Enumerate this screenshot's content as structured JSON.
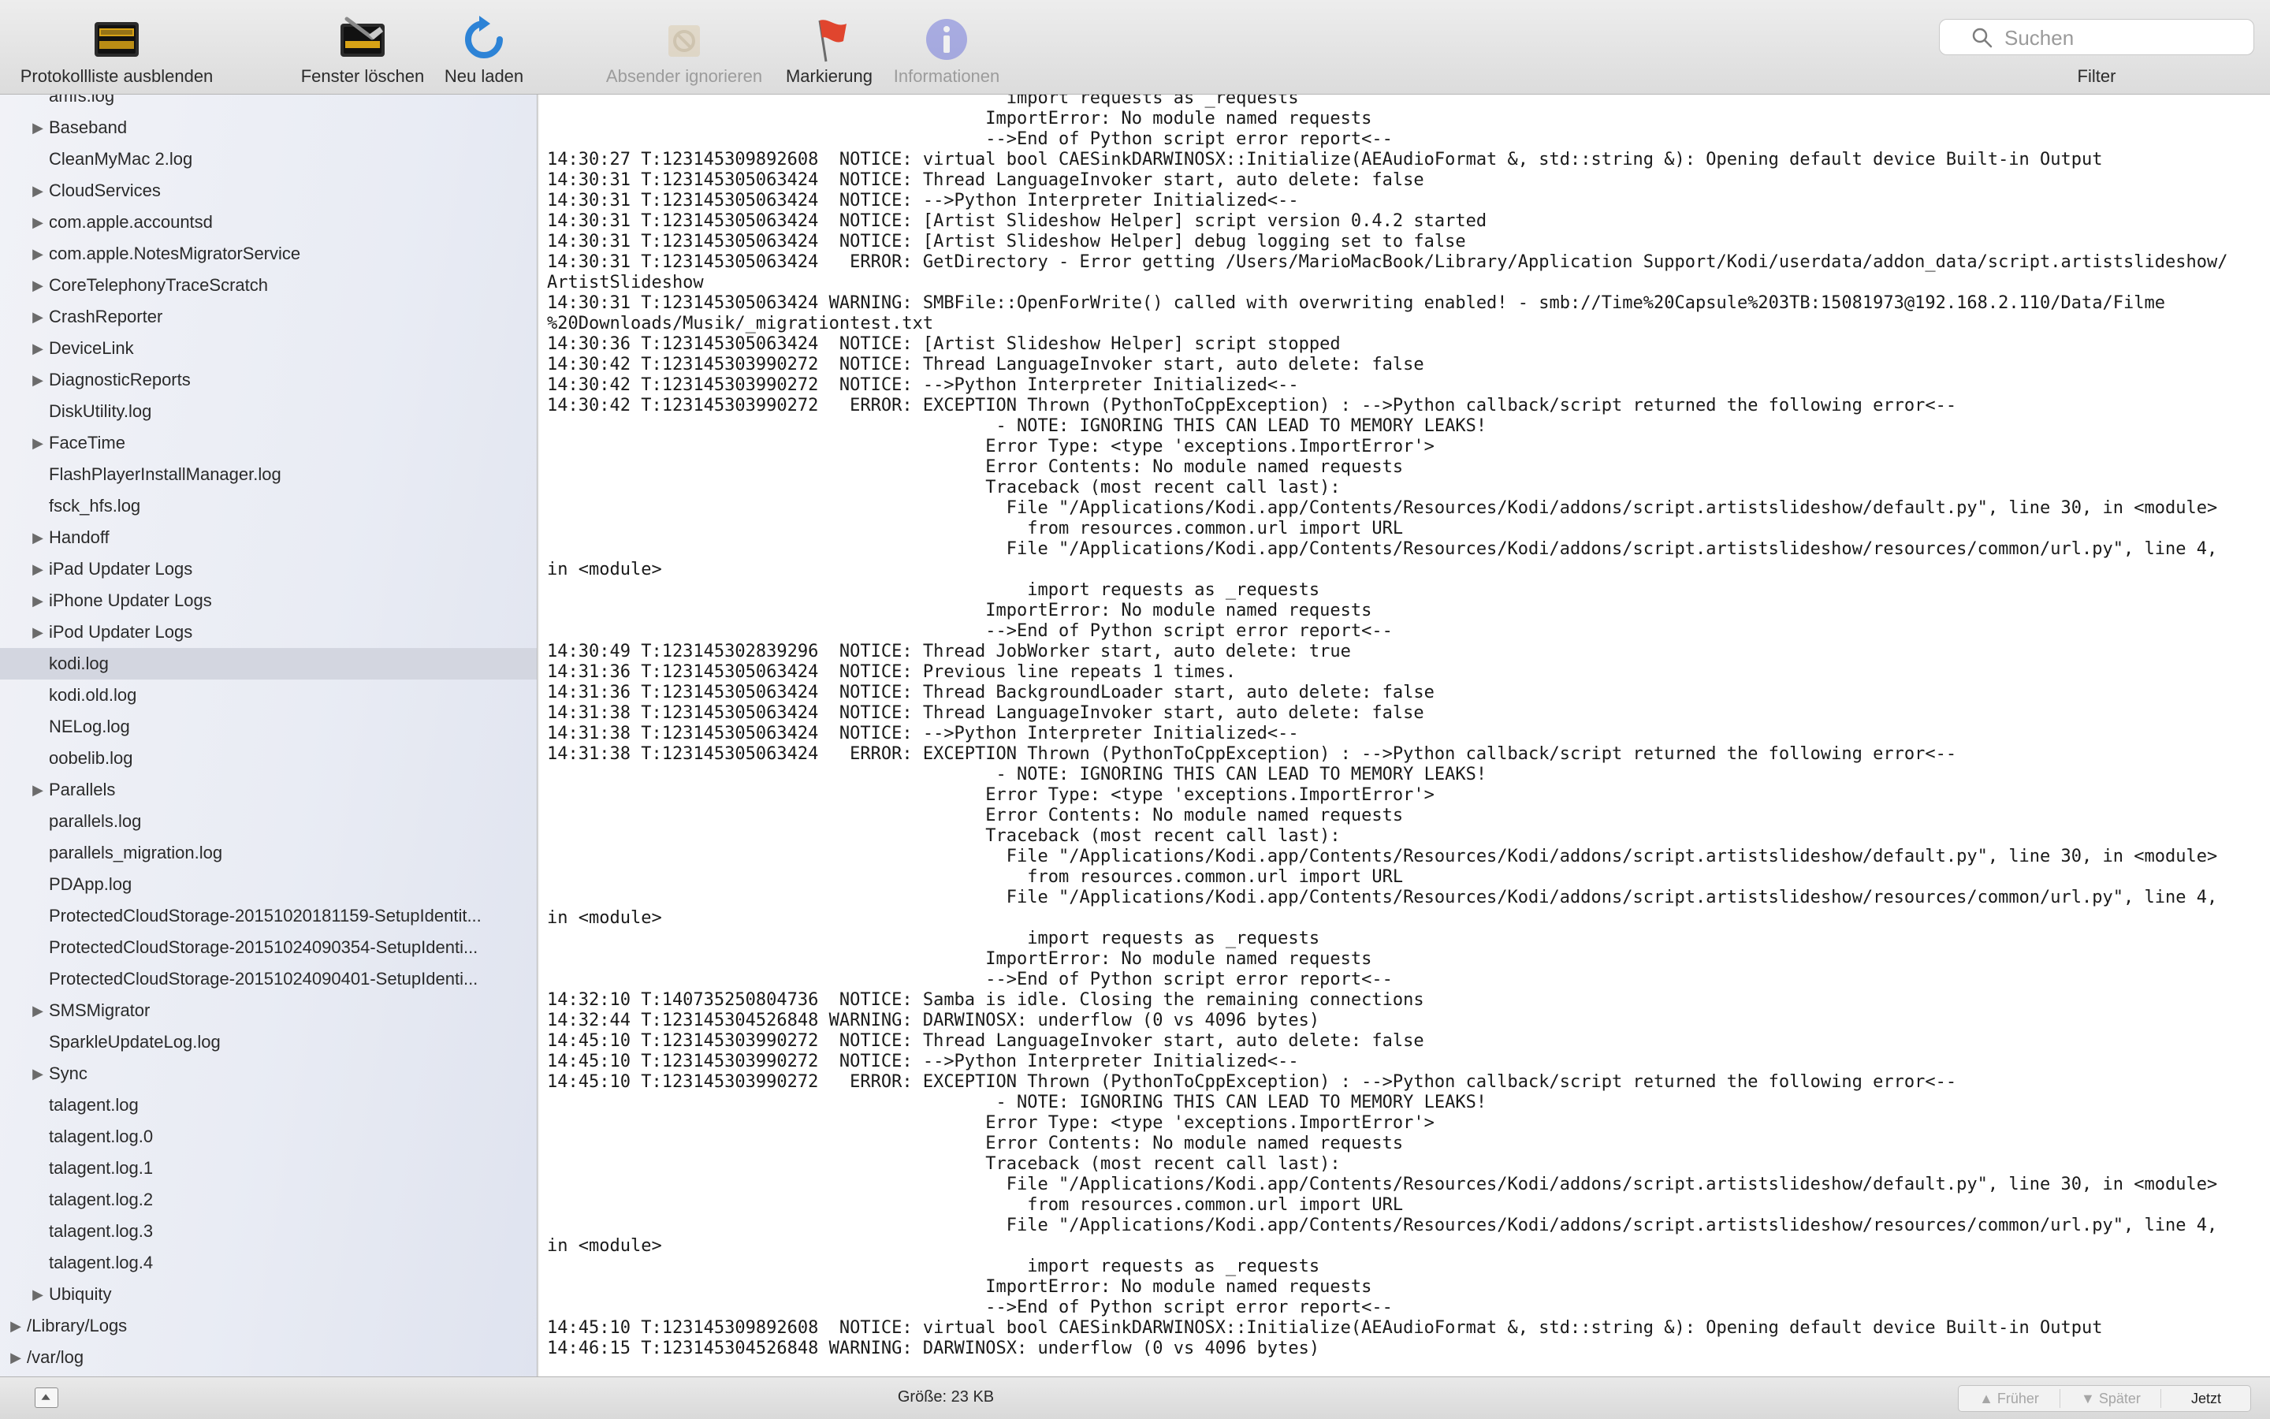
{
  "toolbar": {
    "hide_log_list": "Protokollliste ausblenden",
    "clear_window": "Fenster löschen",
    "reload": "Neu laden",
    "ignore_sender": "Absender ignorieren",
    "mark": "Markierung",
    "info": "Informationen",
    "search_placeholder": "Suchen",
    "filter_label": "Filter"
  },
  "sidebar": {
    "items": [
      {
        "label": "amfs.log",
        "expandable": false
      },
      {
        "label": "Baseband",
        "expandable": true
      },
      {
        "label": "CleanMyMac 2.log",
        "expandable": false
      },
      {
        "label": "CloudServices",
        "expandable": true
      },
      {
        "label": "com.apple.accountsd",
        "expandable": true
      },
      {
        "label": "com.apple.NotesMigratorService",
        "expandable": true
      },
      {
        "label": "CoreTelephonyTraceScratch",
        "expandable": true
      },
      {
        "label": "CrashReporter",
        "expandable": true
      },
      {
        "label": "DeviceLink",
        "expandable": true
      },
      {
        "label": "DiagnosticReports",
        "expandable": true
      },
      {
        "label": "DiskUtility.log",
        "expandable": false
      },
      {
        "label": "FaceTime",
        "expandable": true
      },
      {
        "label": "FlashPlayerInstallManager.log",
        "expandable": false
      },
      {
        "label": "fsck_hfs.log",
        "expandable": false
      },
      {
        "label": "Handoff",
        "expandable": true
      },
      {
        "label": "iPad Updater Logs",
        "expandable": true
      },
      {
        "label": "iPhone Updater Logs",
        "expandable": true
      },
      {
        "label": "iPod Updater Logs",
        "expandable": true
      },
      {
        "label": "kodi.log",
        "expandable": false,
        "selected": true
      },
      {
        "label": "kodi.old.log",
        "expandable": false
      },
      {
        "label": "NELog.log",
        "expandable": false
      },
      {
        "label": "oobelib.log",
        "expandable": false
      },
      {
        "label": "Parallels",
        "expandable": true
      },
      {
        "label": "parallels.log",
        "expandable": false
      },
      {
        "label": "parallels_migration.log",
        "expandable": false
      },
      {
        "label": "PDApp.log",
        "expandable": false
      },
      {
        "label": "ProtectedCloudStorage-20151020181159-SetupIdentit...",
        "expandable": false
      },
      {
        "label": "ProtectedCloudStorage-20151024090354-SetupIdenti...",
        "expandable": false
      },
      {
        "label": "ProtectedCloudStorage-20151024090401-SetupIdenti...",
        "expandable": false
      },
      {
        "label": "SMSMigrator",
        "expandable": true
      },
      {
        "label": "SparkleUpdateLog.log",
        "expandable": false
      },
      {
        "label": "Sync",
        "expandable": true
      },
      {
        "label": "talagent.log",
        "expandable": false
      },
      {
        "label": "talagent.log.0",
        "expandable": false
      },
      {
        "label": "talagent.log.1",
        "expandable": false
      },
      {
        "label": "talagent.log.2",
        "expandable": false
      },
      {
        "label": "talagent.log.3",
        "expandable": false
      },
      {
        "label": "talagent.log.4",
        "expandable": false
      },
      {
        "label": "Ubiquity",
        "expandable": true
      },
      {
        "label": "/Library/Logs",
        "expandable": true,
        "top_level": true
      },
      {
        "label": "/var/log",
        "expandable": true,
        "top_level": true
      }
    ]
  },
  "log_lines": [
    "                                            import requests as _requests",
    "                                          ImportError: No module named requests",
    "                                          -->End of Python script error report<--",
    "14:30:27 T:123145309892608  NOTICE: virtual bool CAESinkDARWINOSX::Initialize(AEAudioFormat &, std::string &): Opening default device Built-in Output",
    "14:30:31 T:123145305063424  NOTICE: Thread LanguageInvoker start, auto delete: false",
    "14:30:31 T:123145305063424  NOTICE: -->Python Interpreter Initialized<--",
    "14:30:31 T:123145305063424  NOTICE: [Artist Slideshow Helper] script version 0.4.2 started",
    "14:30:31 T:123145305063424  NOTICE: [Artist Slideshow Helper] debug logging set to false",
    "14:30:31 T:123145305063424   ERROR: GetDirectory - Error getting /Users/MarioMacBook/Library/Application Support/Kodi/userdata/addon_data/script.artistslideshow/",
    "ArtistSlideshow",
    "14:30:31 T:123145305063424 WARNING: SMBFile::OpenForWrite() called with overwriting enabled! - smb://Time%20Capsule%203TB:15081973@192.168.2.110/Data/Filme",
    "%20Downloads/Musik/_migrationtest.txt",
    "14:30:36 T:123145305063424  NOTICE: [Artist Slideshow Helper] script stopped",
    "14:30:42 T:123145303990272  NOTICE: Thread LanguageInvoker start, auto delete: false",
    "14:30:42 T:123145303990272  NOTICE: -->Python Interpreter Initialized<--",
    "14:30:42 T:123145303990272   ERROR: EXCEPTION Thrown (PythonToCppException) : -->Python callback/script returned the following error<--",
    "                                           - NOTE: IGNORING THIS CAN LEAD TO MEMORY LEAKS!",
    "                                          Error Type: <type 'exceptions.ImportError'>",
    "                                          Error Contents: No module named requests",
    "                                          Traceback (most recent call last):",
    "                                            File \"/Applications/Kodi.app/Contents/Resources/Kodi/addons/script.artistslideshow/default.py\", line 30, in <module>",
    "                                              from resources.common.url import URL",
    "                                            File \"/Applications/Kodi.app/Contents/Resources/Kodi/addons/script.artistslideshow/resources/common/url.py\", line 4,",
    "in <module>",
    "                                              import requests as _requests",
    "                                          ImportError: No module named requests",
    "                                          -->End of Python script error report<--",
    "14:30:49 T:123145302839296  NOTICE: Thread JobWorker start, auto delete: true",
    "14:31:36 T:123145305063424  NOTICE: Previous line repeats 1 times.",
    "14:31:36 T:123145305063424  NOTICE: Thread BackgroundLoader start, auto delete: false",
    "14:31:38 T:123145305063424  NOTICE: Thread LanguageInvoker start, auto delete: false",
    "14:31:38 T:123145305063424  NOTICE: -->Python Interpreter Initialized<--",
    "14:31:38 T:123145305063424   ERROR: EXCEPTION Thrown (PythonToCppException) : -->Python callback/script returned the following error<--",
    "                                           - NOTE: IGNORING THIS CAN LEAD TO MEMORY LEAKS!",
    "                                          Error Type: <type 'exceptions.ImportError'>",
    "                                          Error Contents: No module named requests",
    "                                          Traceback (most recent call last):",
    "                                            File \"/Applications/Kodi.app/Contents/Resources/Kodi/addons/script.artistslideshow/default.py\", line 30, in <module>",
    "                                              from resources.common.url import URL",
    "                                            File \"/Applications/Kodi.app/Contents/Resources/Kodi/addons/script.artistslideshow/resources/common/url.py\", line 4,",
    "in <module>",
    "                                              import requests as _requests",
    "                                          ImportError: No module named requests",
    "                                          -->End of Python script error report<--",
    "14:32:10 T:140735250804736  NOTICE: Samba is idle. Closing the remaining connections",
    "14:32:44 T:123145304526848 WARNING: DARWINOSX: underflow (0 vs 4096 bytes)",
    "14:45:10 T:123145303990272  NOTICE: Thread LanguageInvoker start, auto delete: false",
    "14:45:10 T:123145303990272  NOTICE: -->Python Interpreter Initialized<--",
    "14:45:10 T:123145303990272   ERROR: EXCEPTION Thrown (PythonToCppException) : -->Python callback/script returned the following error<--",
    "                                           - NOTE: IGNORING THIS CAN LEAD TO MEMORY LEAKS!",
    "                                          Error Type: <type 'exceptions.ImportError'>",
    "                                          Error Contents: No module named requests",
    "                                          Traceback (most recent call last):",
    "                                            File \"/Applications/Kodi.app/Contents/Resources/Kodi/addons/script.artistslideshow/default.py\", line 30, in <module>",
    "                                              from resources.common.url import URL",
    "                                            File \"/Applications/Kodi.app/Contents/Resources/Kodi/addons/script.artistslideshow/resources/common/url.py\", line 4,",
    "in <module>",
    "                                              import requests as _requests",
    "                                          ImportError: No module named requests",
    "                                          -->End of Python script error report<--",
    "14:45:10 T:123145309892608  NOTICE: virtual bool CAESinkDARWINOSX::Initialize(AEAudioFormat &, std::string &): Opening default device Built-in Output",
    "14:46:15 T:123145304526848 WARNING: DARWINOSX: underflow (0 vs 4096 bytes)"
  ],
  "status": {
    "size_label": "Größe: 23 KB",
    "earlier": "Früher",
    "later": "Später",
    "now": "Jetzt"
  }
}
